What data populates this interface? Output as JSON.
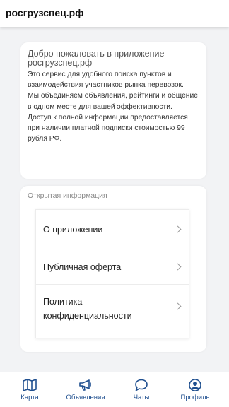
{
  "header": {
    "title": "росгрузспец.рф"
  },
  "welcome": {
    "title": "Добро пожаловать в приложение росгрузспец.рф",
    "paragraphs": [
      "Это сервис для удобного поиска пунктов и взаимодействия участников рынка перевозок.",
      "Мы объединяем объявления, рейтинги и общение в одном месте для вашей эффективности.",
      "Доступ к полной информации предоставляется при наличии платной подписки стоимостью 99 рубля РФ."
    ]
  },
  "open_info": {
    "heading": "Открытая информация",
    "items": [
      {
        "label": "О приложении"
      },
      {
        "label": "Публичная оферта"
      },
      {
        "label": "Политика конфиденциальности"
      }
    ]
  },
  "tabbar": {
    "items": [
      {
        "label": "Карта",
        "icon": "map-icon"
      },
      {
        "label": "Объявления",
        "icon": "megaphone-icon"
      },
      {
        "label": "Чаты",
        "icon": "chat-icon"
      },
      {
        "label": "Профиль",
        "icon": "profile-icon"
      }
    ],
    "color": "#1f4f8f"
  }
}
